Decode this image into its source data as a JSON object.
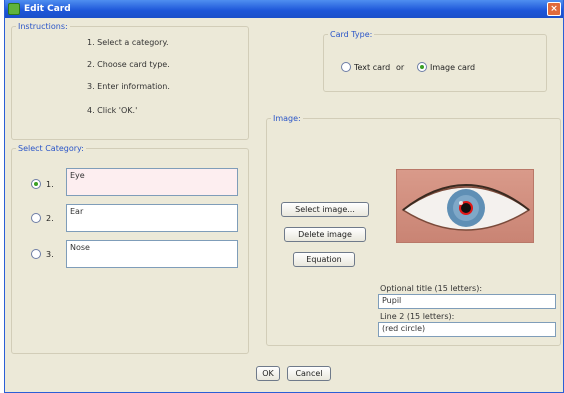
{
  "window": {
    "title": "Edit Card",
    "close_glyph": "×"
  },
  "instructions": {
    "legend": "Instructions:",
    "steps": [
      "1. Select a category.",
      "2. Choose card type.",
      "3. Enter information.",
      "4. Click 'OK.'"
    ]
  },
  "card_type": {
    "legend": "Card Type:",
    "text_card": "Text card",
    "or": "or",
    "image_card": "Image card",
    "selected": "image"
  },
  "category": {
    "legend": "Select Category:",
    "items": [
      {
        "num": "1.",
        "value": "Eye",
        "selected": true
      },
      {
        "num": "2.",
        "value": "Ear",
        "selected": false
      },
      {
        "num": "3.",
        "value": "Nose",
        "selected": false
      }
    ]
  },
  "image": {
    "legend": "Image:",
    "select_button": "Select image...",
    "delete_button": "Delete image",
    "equation_button": "Equation",
    "optional_title_label": "Optional title (15 letters):",
    "optional_title_value": "Pupil",
    "line2_label": "Line 2 (15 letters):",
    "line2_value": "(red circle)",
    "picture_icon": "eye-photo"
  },
  "footer": {
    "ok": "OK",
    "cancel": "Cancel"
  }
}
